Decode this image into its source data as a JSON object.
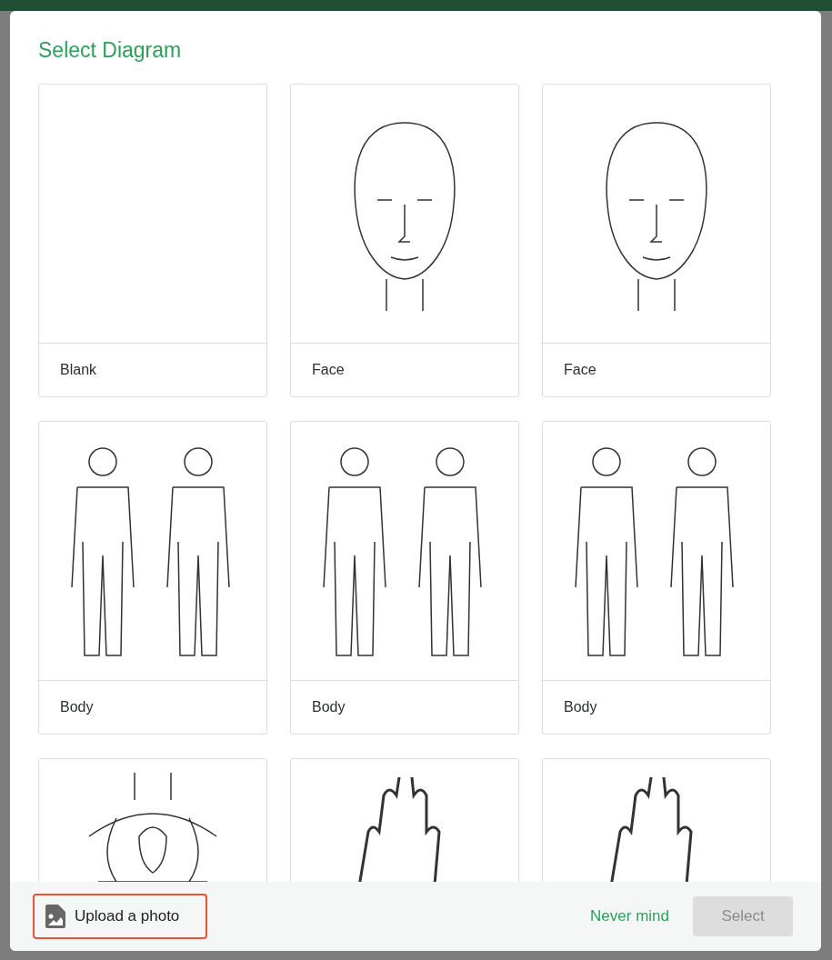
{
  "dialog": {
    "title": "Select Diagram",
    "diagrams": [
      {
        "kind": "blank",
        "label": "Blank"
      },
      {
        "kind": "face",
        "label": "Face"
      },
      {
        "kind": "face",
        "label": "Face"
      },
      {
        "kind": "body",
        "label": "Body"
      },
      {
        "kind": "body",
        "label": "Body"
      },
      {
        "kind": "body",
        "label": "Body"
      },
      {
        "kind": "organs"
      },
      {
        "kind": "hand"
      },
      {
        "kind": "hand"
      }
    ],
    "upload_button": "Upload a photo",
    "cancel_button": "Never mind",
    "select_button": {
      "label": "Select",
      "disabled": true
    }
  }
}
